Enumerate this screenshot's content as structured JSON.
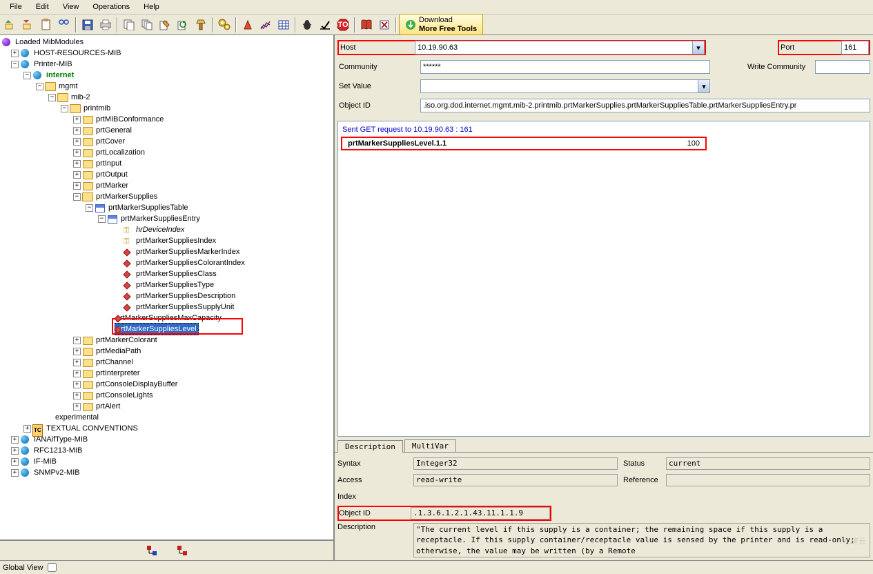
{
  "menu": {
    "file": "File",
    "edit": "Edit",
    "view": "View",
    "operations": "Operations",
    "help": "Help"
  },
  "download_btn": {
    "line1": "Download",
    "line2": "More Free Tools"
  },
  "tree_root": "Loaded MibModules",
  "tree": {
    "host_res": "HOST-RESOURCES-MIB",
    "printer": "Printer-MIB",
    "internet": "internet",
    "mgmt": "mgmt",
    "mib2": "mib-2",
    "printmib": "printmib",
    "conformance": "prtMIBConformance",
    "general": "prtGeneral",
    "cover": "prtCover",
    "localization": "prtLocalization",
    "input": "prtInput",
    "output": "prtOutput",
    "marker": "prtMarker",
    "supplies": "prtMarkerSupplies",
    "sup_table": "prtMarkerSuppliesTable",
    "sup_entry": "prtMarkerSuppliesEntry",
    "hr_index": "hrDeviceIndex",
    "sup_index": "prtMarkerSuppliesIndex",
    "sup_marker": "prtMarkerSuppliesMarkerIndex",
    "sup_colorant": "prtMarkerSuppliesColorantIndex",
    "sup_class": "prtMarkerSuppliesClass",
    "sup_type": "prtMarkerSuppliesType",
    "sup_desc": "prtMarkerSuppliesDescription",
    "sup_unit": "prtMarkerSuppliesSupplyUnit",
    "sup_max": "prtMarkerSuppliesMaxCapacity",
    "sup_level": "prtMarkerSuppliesLevel",
    "colorant": "prtMarkerColorant",
    "mediapath": "prtMediaPath",
    "channel": "prtChannel",
    "interpreter": "prtInterpreter",
    "console": "prtConsoleDisplayBuffer",
    "lights": "prtConsoleLights",
    "alert": "prtAlert",
    "experimental": "experimental",
    "textconv": "TEXTUAL CONVENTIONS",
    "iana": "IANAifType-MIB",
    "rfc1213": "RFC1213-MIB",
    "ifmib": "IF-MIB",
    "snmpv2": "SNMPv2-MIB"
  },
  "form": {
    "host_label": "Host",
    "host": "10.19.90.63",
    "port_label": "Port",
    "port": "161",
    "community_label": "Community",
    "community": "******",
    "wcommunity_label": "Write Community",
    "wcommunity": "",
    "setvalue_label": "Set Value",
    "setvalue": "",
    "objectid_label": "Object ID",
    "objectid": ".iso.org.dod.internet.mgmt.mib-2.printmib.prtMarkerSupplies.prtMarkerSuppliesTable.prtMarkerSuppliesEntry.pr"
  },
  "result": {
    "status": "Sent GET request to 10.19.90.63 : 161",
    "name": "prtMarkerSuppliesLevel.1.1",
    "value": "100"
  },
  "tabs": {
    "desc": "Description",
    "multi": "MultiVar"
  },
  "desc": {
    "syntax_l": "Syntax",
    "syntax": "Integer32",
    "status_l": "Status",
    "status": "current",
    "access_l": "Access",
    "access": "read-write",
    "reference_l": "Reference",
    "reference": "",
    "index_l": "Index",
    "oid_l": "Object ID",
    "oid": ".1.3.6.1.2.1.43.11.1.1.9",
    "desc_l": "Description",
    "desc": "\"The current level if this supply is a container; the remaining space if this supply is a receptacle. If this supply container/receptacle value is sensed by the printer and is read-only; otherwise, the value may be written (by a Remote"
  },
  "status_bar": {
    "global": "Global View"
  },
  "watermark": "亿速云"
}
